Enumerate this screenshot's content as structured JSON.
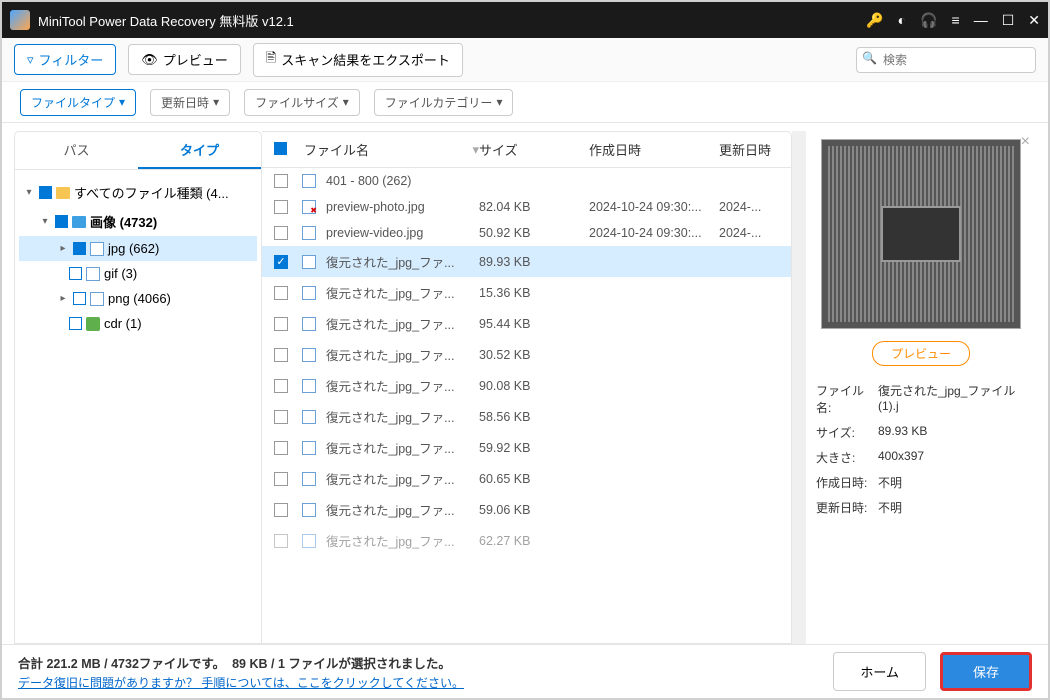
{
  "title": "MiniTool Power Data Recovery 無料版 v12.1",
  "toolbar": {
    "filter": "フィルター",
    "preview": "プレビュー",
    "export": "スキャン結果をエクスポート",
    "search_placeholder": "検索"
  },
  "filters": {
    "filetype": "ファイルタイプ",
    "modified": "更新日時",
    "filesize": "ファイルサイズ",
    "category": "ファイルカテゴリー"
  },
  "tabs": {
    "path": "パス",
    "type": "タイプ"
  },
  "tree": {
    "all": "すべてのファイル種類 (4...",
    "images": "画像 (4732)",
    "jpg": "jpg (662)",
    "gif": "gif (3)",
    "png": "png (4066)",
    "cdr": "cdr (1)"
  },
  "columns": {
    "name": "ファイル名",
    "size": "サイズ",
    "created": "作成日時",
    "modified": "更新日時"
  },
  "rows": [
    {
      "name": "401 - 800 (262)",
      "size": "",
      "created": "",
      "modified": "",
      "folder": true
    },
    {
      "name": "preview-photo.jpg",
      "size": "82.04 KB",
      "created": "2024-10-24 09:30:...",
      "modified": "2024-...",
      "deleted": true
    },
    {
      "name": "preview-video.jpg",
      "size": "50.92 KB",
      "created": "2024-10-24 09:30:...",
      "modified": "2024-..."
    },
    {
      "name": "復元された_jpg_ファ...",
      "size": "89.93 KB",
      "created": "",
      "modified": "",
      "selected": true,
      "checked": true
    },
    {
      "name": "復元された_jpg_ファ...",
      "size": "15.36 KB",
      "created": "",
      "modified": ""
    },
    {
      "name": "復元された_jpg_ファ...",
      "size": "95.44 KB",
      "created": "",
      "modified": ""
    },
    {
      "name": "復元された_jpg_ファ...",
      "size": "30.52 KB",
      "created": "",
      "modified": ""
    },
    {
      "name": "復元された_jpg_ファ...",
      "size": "90.08 KB",
      "created": "",
      "modified": ""
    },
    {
      "name": "復元された_jpg_ファ...",
      "size": "58.56 KB",
      "created": "",
      "modified": ""
    },
    {
      "name": "復元された_jpg_ファ...",
      "size": "59.92 KB",
      "created": "",
      "modified": ""
    },
    {
      "name": "復元された_jpg_ファ...",
      "size": "60.65 KB",
      "created": "",
      "modified": ""
    },
    {
      "name": "復元された_jpg_ファ...",
      "size": "59.06 KB",
      "created": "",
      "modified": ""
    },
    {
      "name": "復元された_jpg_ファ...",
      "size": "62.27 KB",
      "created": "",
      "modified": "",
      "cut": true
    }
  ],
  "preview": {
    "button": "プレビュー",
    "name_k": "ファイル名:",
    "name_v": "復元された_jpg_ファイル(1).j",
    "size_k": "サイズ:",
    "size_v": "89.93 KB",
    "dim_k": "大きさ:",
    "dim_v": "400x397",
    "created_k": "作成日時:",
    "created_v": "不明",
    "modified_k": "更新日時:",
    "modified_v": "不明"
  },
  "footer": {
    "total": "合計 221.2 MB / 4732ファイルです。",
    "selected": "89 KB / 1 ファイルが選択されました。",
    "link": "データ復旧に問題がありますか？ 手順については、ここをクリックしてください。",
    "home": "ホーム",
    "save": "保存"
  }
}
